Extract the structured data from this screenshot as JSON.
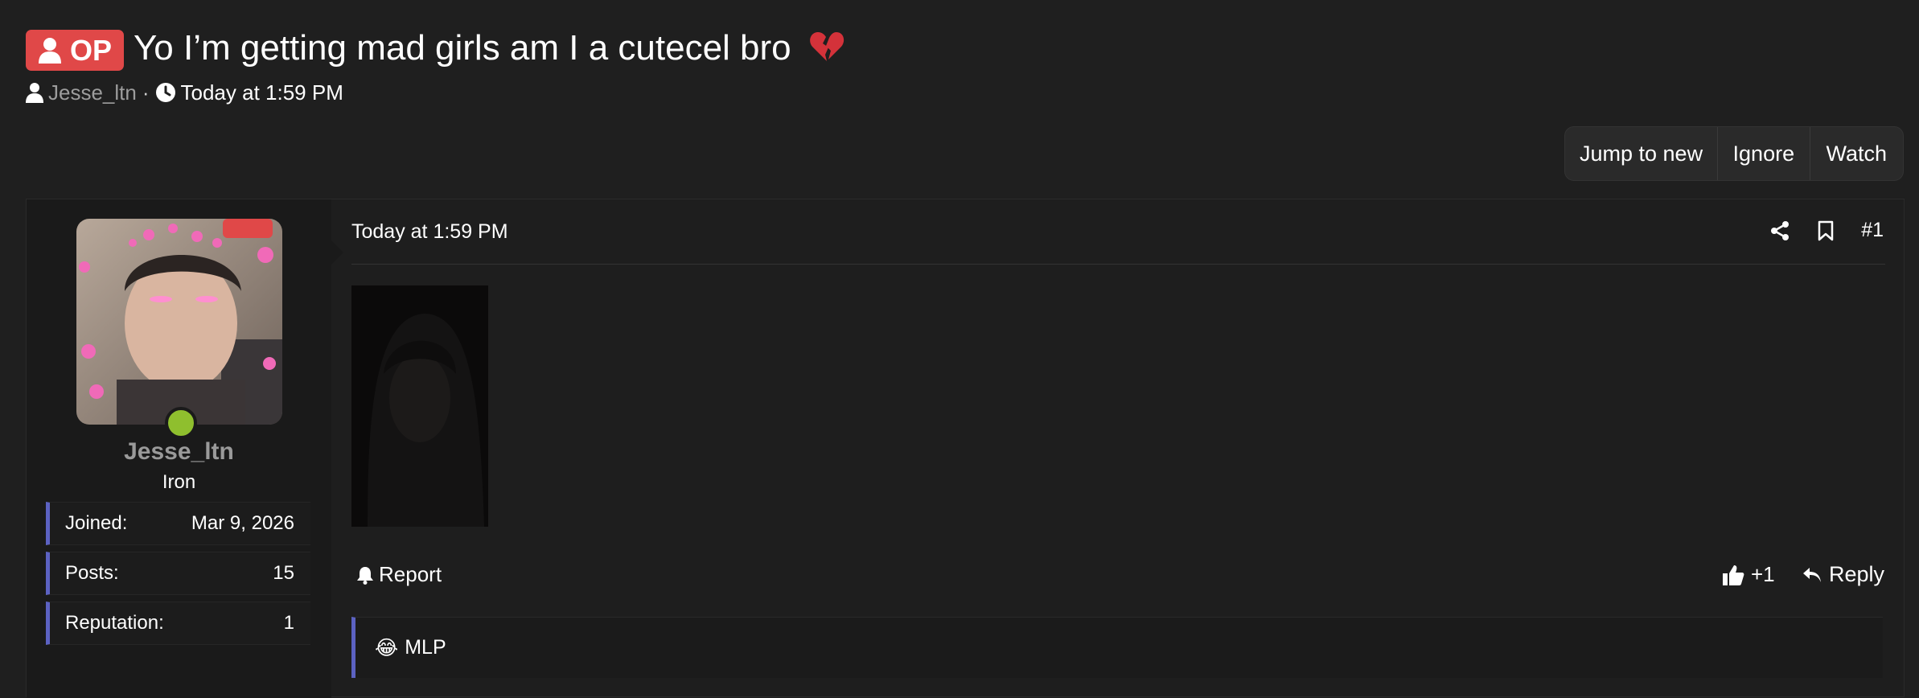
{
  "thread": {
    "op_badge": "OP",
    "title": "Yo I’m getting mad girls am I a cutecel bro",
    "author": "Jesse_ltn",
    "separator": "·",
    "posted": "Today at 1:59 PM"
  },
  "thread_buttons": {
    "jump_to_new": "Jump to new",
    "ignore": "Ignore",
    "watch": "Watch"
  },
  "user": {
    "name": "Jesse_ltn",
    "rank": "Iron",
    "stats": [
      {
        "label": "Joined:",
        "value": "Mar 9, 2026"
      },
      {
        "label": "Posts:",
        "value": "15"
      },
      {
        "label": "Reputation:",
        "value": "1"
      }
    ],
    "online_color": "#8fbf2e"
  },
  "post": {
    "date": "Today at 1:59 PM",
    "number": "#1",
    "report": "Report",
    "like_count": "+1",
    "reply": "Reply",
    "reaction_emoji": "😂",
    "reaction_text": "MLP"
  },
  "colors": {
    "accent": "#5c62c2",
    "op_badge": "#e04848",
    "background": "#1f1f1f"
  }
}
